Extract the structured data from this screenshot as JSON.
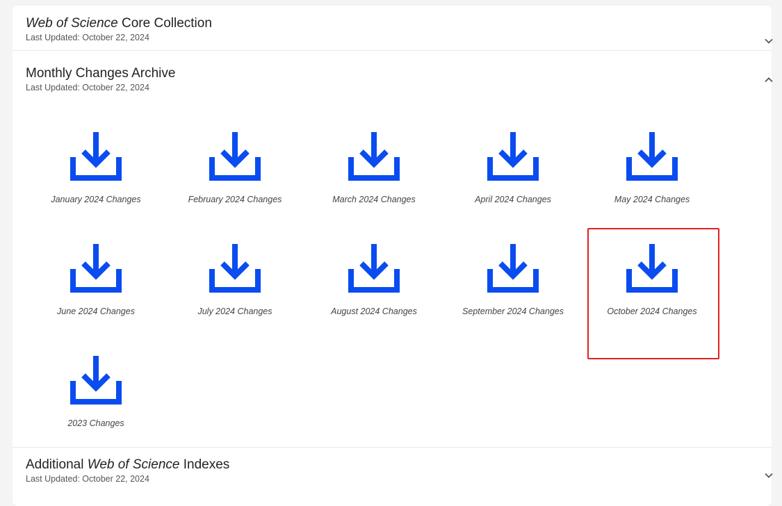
{
  "sections": {
    "core": {
      "title_italic": "Web of Science",
      "title_rest": " Core Collection",
      "updated": "Last Updated: October 22, 2024",
      "chevron": "chevron-down-icon"
    },
    "monthly": {
      "title": "Monthly Changes Archive",
      "updated": "Last Updated: October 22, 2024",
      "chevron": "chevron-up-icon"
    },
    "additional": {
      "title_pre": "Additional ",
      "title_italic": "Web of Science",
      "title_rest": " Indexes",
      "updated": "Last Updated: October 22, 2024",
      "chevron": "chevron-down-icon"
    }
  },
  "downloads": [
    {
      "label": "January 2024 Changes"
    },
    {
      "label": "February 2024 Changes"
    },
    {
      "label": "March 2024 Changes"
    },
    {
      "label": "April 2024 Changes"
    },
    {
      "label": "May 2024 Changes"
    },
    {
      "label": "June 2024 Changes"
    },
    {
      "label": "July 2024 Changes"
    },
    {
      "label": "August 2024 Changes"
    },
    {
      "label": "September 2024 Changes"
    },
    {
      "label": "October 2024 Changes"
    },
    {
      "label": "2023 Changes"
    }
  ],
  "icon": "download-icon",
  "colors": {
    "icon": "#0a4cf0",
    "highlight": "#e02020"
  }
}
